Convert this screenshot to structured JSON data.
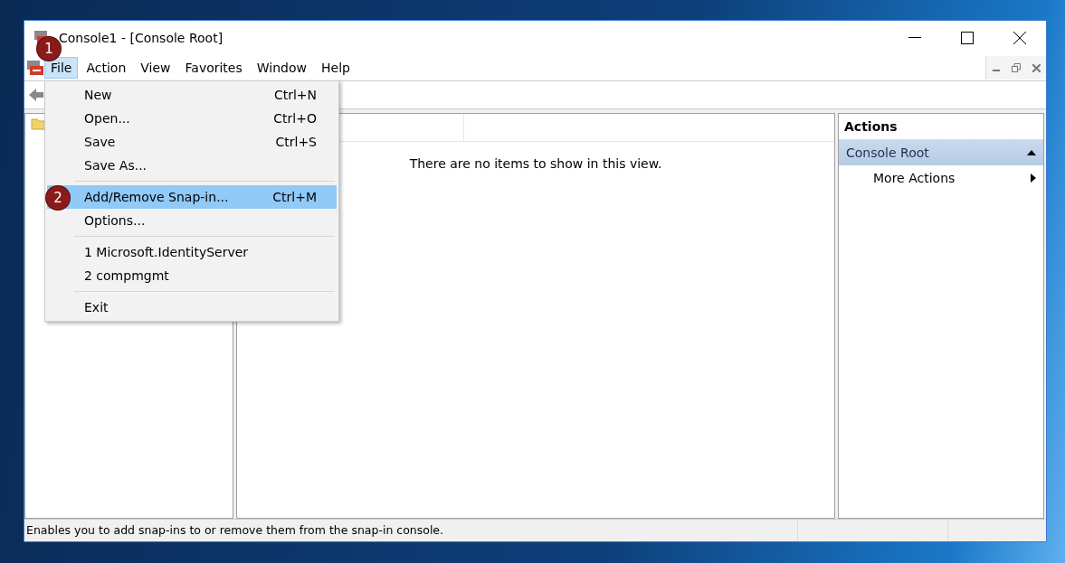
{
  "window": {
    "title": "Console1 - [Console Root]"
  },
  "menu_bar": [
    {
      "label": "File",
      "selected": true,
      "badge": "1"
    },
    {
      "label": "Action",
      "selected": false
    },
    {
      "label": "View",
      "selected": false
    },
    {
      "label": "Favorites",
      "selected": false
    },
    {
      "label": "Window",
      "selected": false
    },
    {
      "label": "Help",
      "selected": false
    }
  ],
  "file_menu": {
    "items": [
      {
        "kind": "item",
        "label": "New",
        "shortcut": "Ctrl+N",
        "selected": false
      },
      {
        "kind": "item",
        "label": "Open...",
        "shortcut": "Ctrl+O",
        "selected": false
      },
      {
        "kind": "item",
        "label": "Save",
        "shortcut": "Ctrl+S",
        "selected": false
      },
      {
        "kind": "item",
        "label": "Save As...",
        "selected": false
      },
      {
        "kind": "separator"
      },
      {
        "kind": "item",
        "label": "Add/Remove Snap-in...",
        "shortcut": "Ctrl+M",
        "selected": true,
        "badge": "2"
      },
      {
        "kind": "item",
        "label": "Options...",
        "selected": false
      },
      {
        "kind": "separator"
      },
      {
        "kind": "item",
        "label": "1 Microsoft.IdentityServer",
        "selected": false
      },
      {
        "kind": "item",
        "label": "2 compmgmt",
        "selected": false
      },
      {
        "kind": "separator"
      },
      {
        "kind": "item",
        "label": "Exit",
        "selected": false
      }
    ]
  },
  "center_pane": {
    "message": "There are no items to show in this view."
  },
  "actions_pane": {
    "title": "Actions",
    "sections": [
      {
        "label": "Console Root",
        "expanded": true,
        "items": [
          {
            "label": "More Actions"
          }
        ]
      }
    ]
  },
  "status_bar": {
    "text": "Enables you to add snap-ins to or remove them from the snap-in console."
  }
}
